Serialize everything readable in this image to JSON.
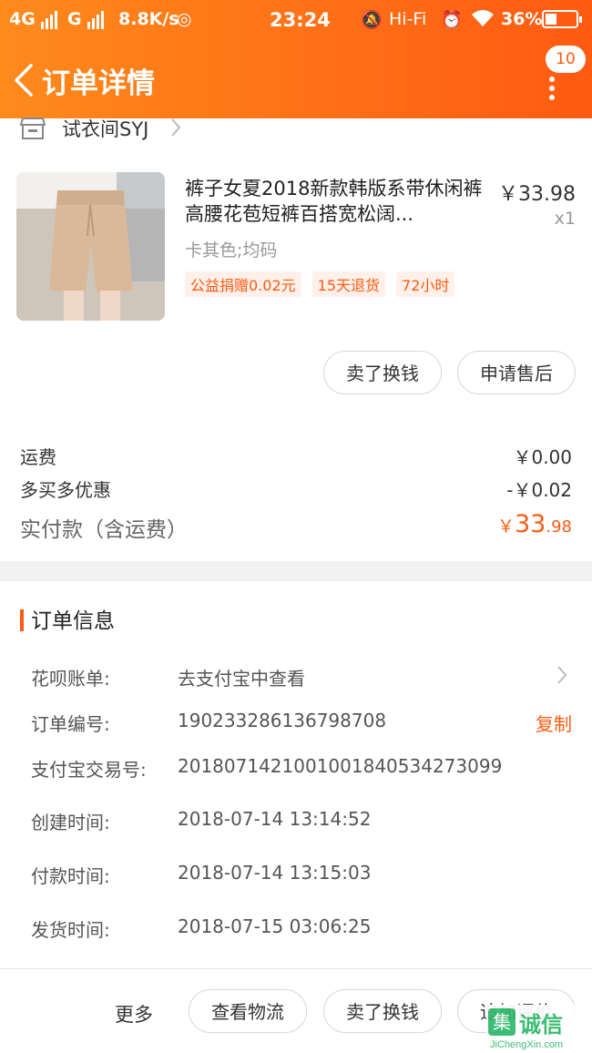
{
  "status_bar": {
    "network1": "4G",
    "network2": "G",
    "speed": "8.8K/s",
    "time": "23:24",
    "hifi": "Hi-Fi",
    "battery": "36%"
  },
  "header": {
    "title": "订单详情",
    "message_count": "10"
  },
  "shop": {
    "name": "试衣间SYJ"
  },
  "product": {
    "title": "裤子女夏2018新款韩版系带休闲裤高腰花苞短裤百搭宽松阔...",
    "sku": "卡其色;均码",
    "price": "￥33.98",
    "quantity": "x1",
    "tags": [
      "公益捐赠0.02元",
      "15天退货",
      "72小时"
    ]
  },
  "item_actions": {
    "sell": "卖了换钱",
    "after_sale": "申请售后"
  },
  "fees": {
    "shipping_label": "运费",
    "shipping_value": "￥0.00",
    "discount_label": "多买多优惠",
    "discount_value": "-￥0.02",
    "total_label": "实付款（含运费）",
    "total_currency": "￥",
    "total_int": "33",
    "total_dec": ".98"
  },
  "order_info": {
    "title": "订单信息",
    "huabei_label": "花呗账单:",
    "huabei_value": "去支付宝中查看",
    "order_no_label": "订单编号:",
    "order_no_value": "190233286136798708",
    "copy_label": "复制",
    "alipay_label": "支付宝交易号:",
    "alipay_value": "2018071421001001840534273099",
    "created_label": "创建时间:",
    "created_value": "2018-07-14 13:14:52",
    "paid_label": "付款时间:",
    "paid_value": "2018-07-14 13:15:03",
    "shipped_label": "发货时间:",
    "shipped_value": "2018-07-15 03:06:25"
  },
  "bottom_bar": {
    "more": "更多",
    "logistics": "查看物流",
    "sell": "卖了换钱",
    "review": "追加评价"
  },
  "watermark": {
    "text": "诚信",
    "url": "JiChengXin.com"
  },
  "colors": {
    "accent": "#ff5a12",
    "header_start": "#ff8a1c",
    "header_end": "#ff5a12"
  }
}
